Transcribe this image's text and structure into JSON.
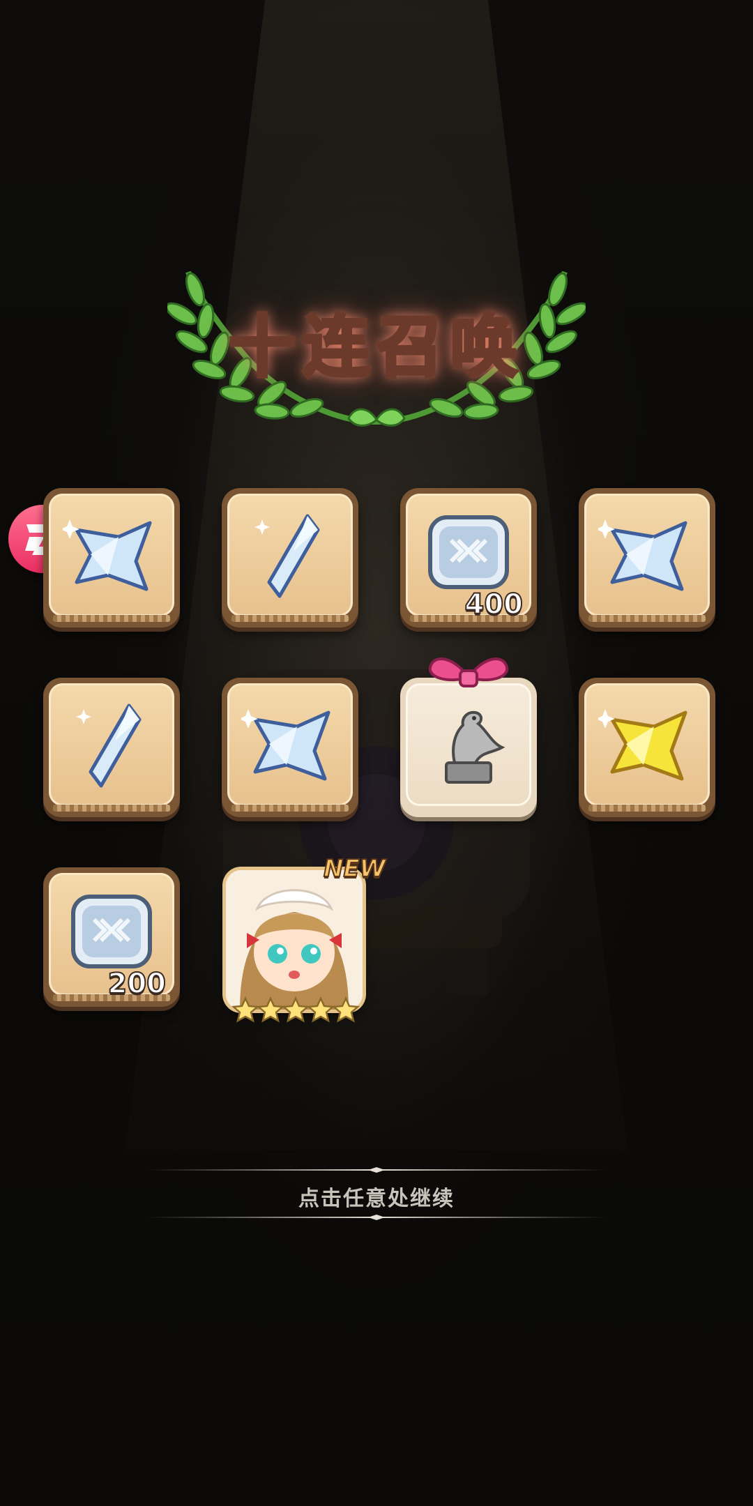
{
  "title": "十连召唤",
  "continue_hint": "点击任意处继续",
  "colors": {
    "background": "#0a0908",
    "title_glow": "#ff9a80",
    "card_border": "#7a5634",
    "card_fill": "#f0d29f",
    "floating_button": "#ee3a68"
  },
  "floating_button": {
    "icon": "d-logo-icon"
  },
  "rewards": [
    {
      "item": "silver-star-gem-icon"
    },
    {
      "item": "silver-rhombus-crystal-icon"
    },
    {
      "item": "silver-plate-icon",
      "count": "400"
    },
    {
      "item": "silver-star-gem-icon"
    },
    {
      "item": "silver-rhombus-crystal-icon"
    },
    {
      "item": "silver-star-gem-icon"
    },
    {
      "item": "bird-statue-icon",
      "special": "gift-bow"
    },
    {
      "item": "gold-star-gem-icon"
    },
    {
      "item": "silver-plate-icon",
      "count": "200"
    },
    {
      "item": "maid-hero-portrait",
      "badge": "NEW",
      "stars": 5
    }
  ]
}
